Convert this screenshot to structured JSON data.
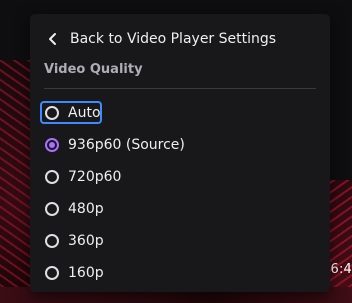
{
  "menu": {
    "back_label": "Back to Video Player Settings",
    "section_title": "Video Quality",
    "options": [
      {
        "label": "Auto",
        "checked": false,
        "focused": true
      },
      {
        "label": "936p60 (Source)",
        "checked": true,
        "focused": false
      },
      {
        "label": "720p60",
        "checked": false,
        "focused": false
      },
      {
        "label": "480p",
        "checked": false,
        "focused": false
      },
      {
        "label": "360p",
        "checked": false,
        "focused": false
      },
      {
        "label": "160p",
        "checked": false,
        "focused": false
      }
    ]
  },
  "player": {
    "time_fragment": "6:4"
  },
  "colors": {
    "panel_bg": "#18181b",
    "accent": "#a970ff",
    "focus_ring": "#3d8bff",
    "secondary_text": "#adadb8"
  },
  "icons": {
    "back": "chevron-left-icon"
  }
}
